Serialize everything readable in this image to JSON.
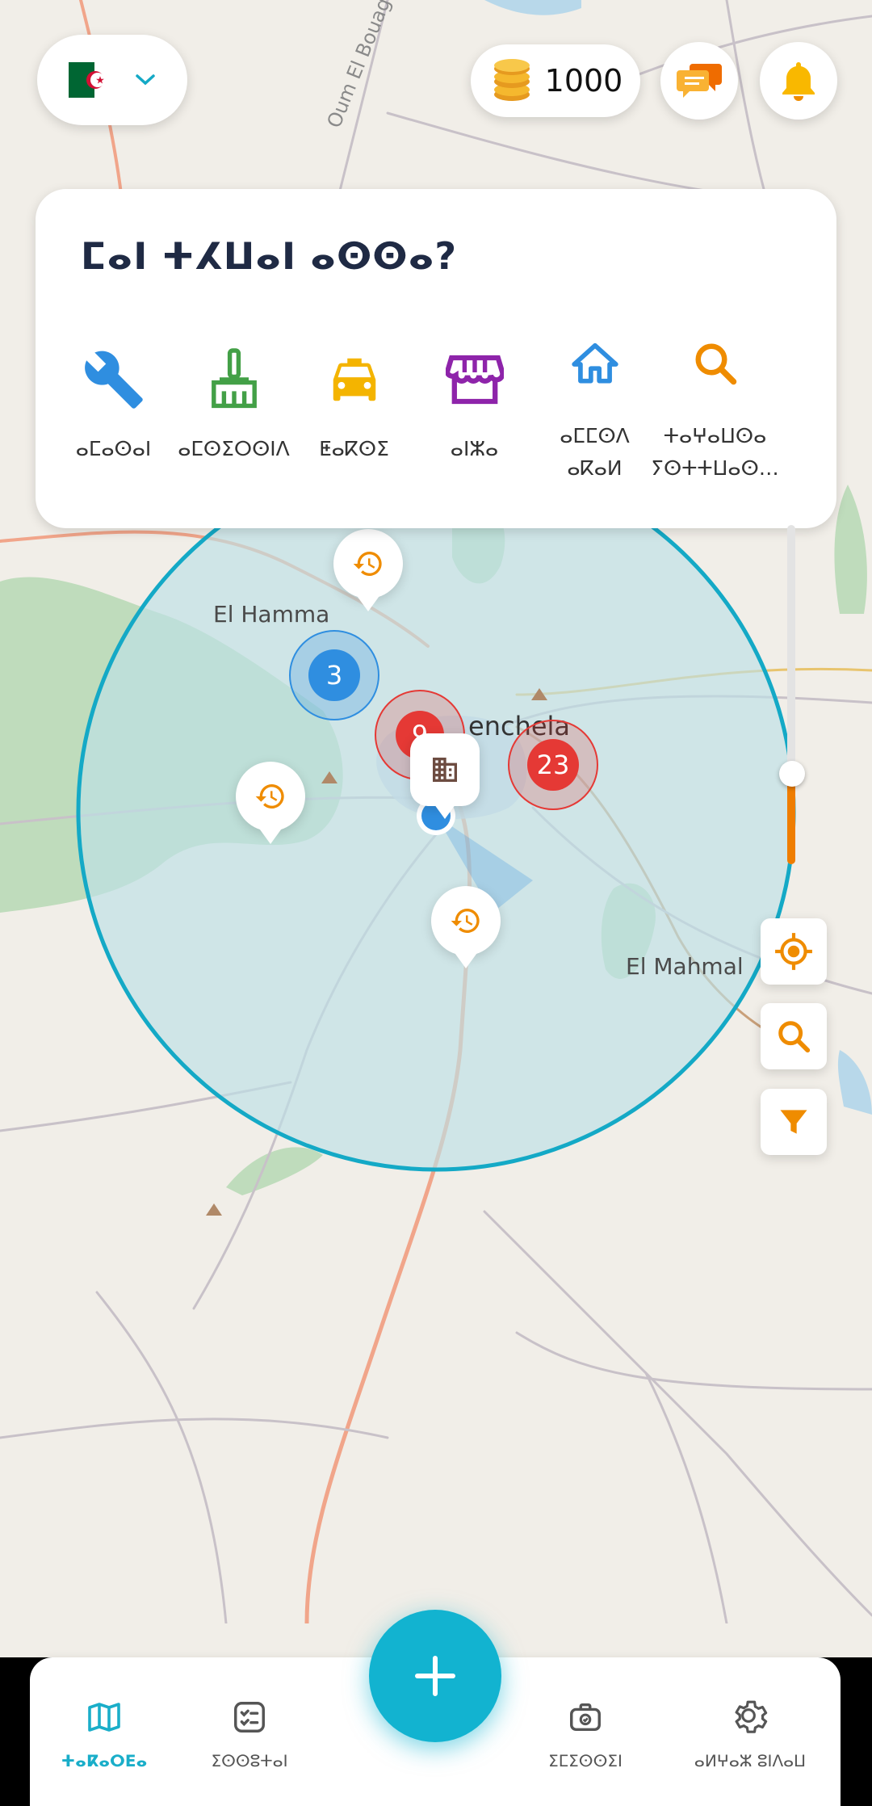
{
  "header": {
    "country_flag": "algeria-flag-icon",
    "coins": "1000",
    "chat_icon": "chat-icon",
    "bell_icon": "bell-icon"
  },
  "services_card": {
    "title": "ⵎⴰⵏ ⵜⵃⵡⴰⵏ ⴰⵙⵙⴰ?",
    "categories": [
      {
        "label": "ⴰⵎⴰⵙⴰⵏ",
        "icon": "wrench-icon",
        "color": "#2f8ee0"
      },
      {
        "label": "ⴰⵎⵙⵉⵔⵙⵏⴷ",
        "icon": "broom-icon",
        "color": "#43a047"
      },
      {
        "label": "ⵟⴰⴽⵙⵉ",
        "icon": "taxi-icon",
        "color": "#f4b400"
      },
      {
        "label": "ⴰⵏⵣⴰ",
        "icon": "store-icon",
        "color": "#8e24aa"
      },
      {
        "label": "ⴰⵎⵎⵙⴷ ⴰⴽⴰⵍ",
        "icon": "home-icon",
        "color": "#2f8ee0"
      },
      {
        "label": "ⵜⴰⵖⴰⵡⵙⴰ ⵢⵙⵜⵜⵡⴰⵙ…",
        "icon": "search-icon",
        "color": "#ef8c00"
      }
    ]
  },
  "map": {
    "places": [
      "El Hamma",
      "enchela",
      "El Mahmal",
      "Oum El Bouag"
    ],
    "clusters": [
      {
        "count": "3",
        "color": "#2f8ee0"
      },
      {
        "count": "9",
        "color": "#e53935"
      },
      {
        "count": "23",
        "color": "#e53935"
      }
    ],
    "radius_fill": "#bde1e6",
    "radius_stroke": "#14a9c6"
  },
  "controls": {
    "locate_icon": "locate-icon",
    "search_icon": "search-icon",
    "filter_icon": "filter-icon",
    "accent": "#ef8c00"
  },
  "nav": {
    "fab_icon": "plus-icon",
    "items": [
      {
        "label": "ⵜⴰⴽⴰⵔⴹⴰ",
        "icon": "map-icon"
      },
      {
        "label": "ⵉⵙⵙⵓⵜⴰⵏ",
        "icon": "tasks-icon"
      },
      {
        "label": "ⵉⵎⵉⵙⵙⵉⵏ",
        "icon": "briefcase-icon"
      },
      {
        "label": "ⴰⵍⵖⴰⵣ ⵓⵏⴷⴰⵡ",
        "icon": "settings-icon"
      }
    ]
  }
}
